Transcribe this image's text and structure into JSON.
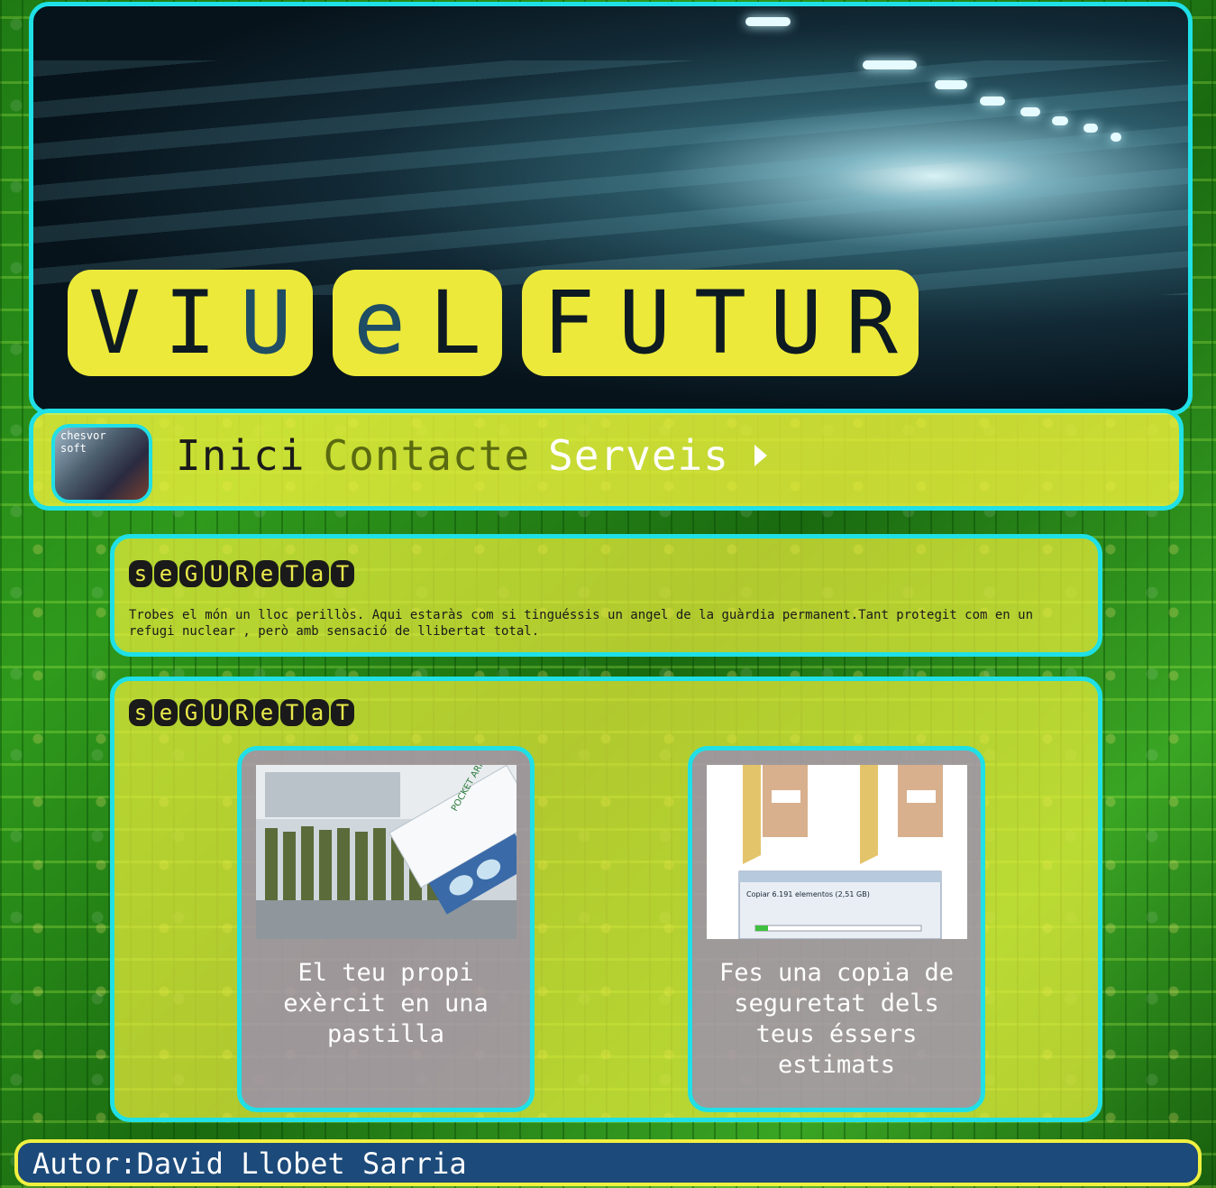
{
  "banner": {
    "title_groups": [
      [
        "V",
        "I",
        "U"
      ],
      [
        "e",
        "L"
      ],
      [
        "F",
        "U",
        "T",
        "U",
        "R"
      ]
    ]
  },
  "nav": {
    "logo_text": "chesvor\nsoft",
    "links": [
      {
        "label": "Inici",
        "color": "#1a1a1a"
      },
      {
        "label": "Contacte",
        "color": "#5a6a10"
      },
      {
        "label": "Serveis",
        "color": "#ffffff"
      }
    ]
  },
  "section1": {
    "title_letters": [
      "s",
      "e",
      "G",
      "U",
      "R",
      "e",
      "T",
      "a",
      "T"
    ],
    "text": "Trobes el món un lloc perillòs. Aqui estaràs com si tinguéssis un angel de la guàrdia permanent.Tant protegit com en un refugi nuclear , però amb sensació de llibertat total."
  },
  "section2": {
    "title_letters": [
      "s",
      "e",
      "G",
      "U",
      "R",
      "e",
      "T",
      "a",
      "T"
    ],
    "cards": [
      {
        "caption": "El teu propi exèrcit en una pastilla",
        "image_label": "POCKET ARMY"
      },
      {
        "caption": "Fes una copia de seguretat dels teus éssers estimats",
        "image_label": "Copiar 6.191 elementos (2,51 GB)"
      }
    ]
  },
  "footer": {
    "text": "Autor:David Llobet Sarria"
  },
  "colors": {
    "accent": "#1fe0e6",
    "panel": "#ece93a",
    "footer": "#1c4a7a"
  }
}
